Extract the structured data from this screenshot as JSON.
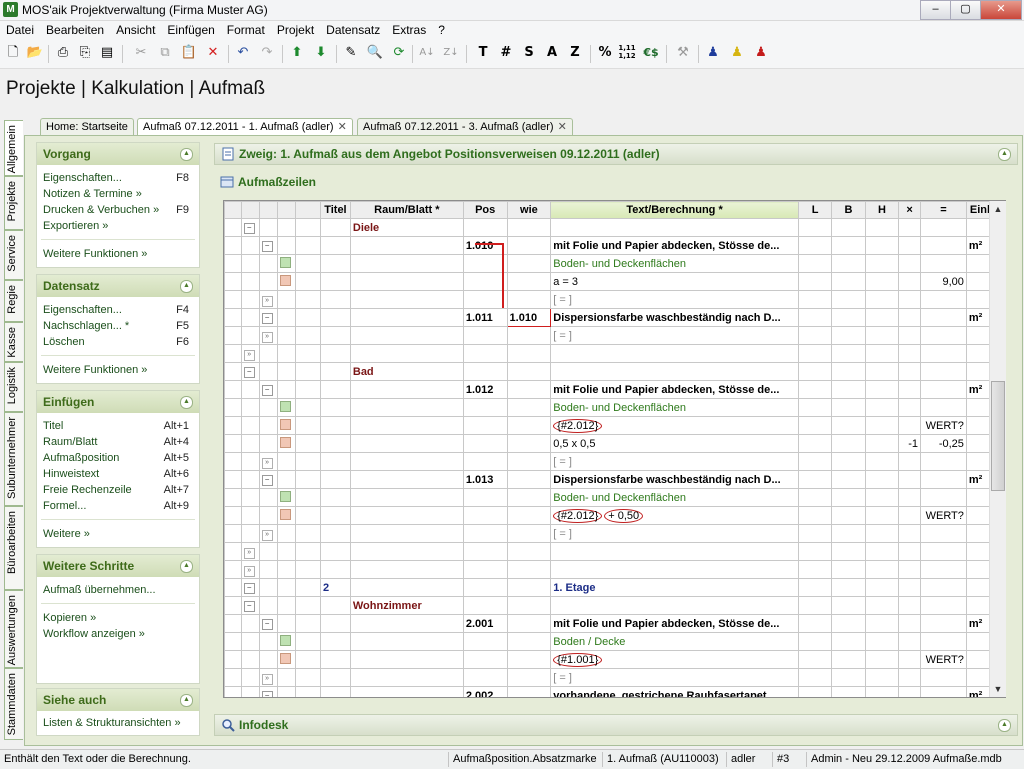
{
  "window": {
    "title": "MOS'aik Projektverwaltung (Firma Muster AG)",
    "min": "–",
    "max": "▢",
    "close": "✕"
  },
  "menu": [
    "Datei",
    "Bearbeiten",
    "Ansicht",
    "Einfügen",
    "Format",
    "Projekt",
    "Datensatz",
    "Extras",
    "?"
  ],
  "toolbar": {
    "t": "T",
    "hash": "#",
    "s": "S",
    "a": "A",
    "z": "Z",
    "pct": "%",
    "dec": "1,11 1,12",
    "eur": "€$"
  },
  "header": "Projekte | Kalkulation | Aufmaß",
  "vtabs": [
    "Allgemein",
    "Projekte",
    "Service",
    "Regie",
    "Kasse",
    "Logistik",
    "Subunternehmer",
    "Büroarbeiten",
    "Auswertungen",
    "Stammdaten"
  ],
  "doc_tabs": [
    {
      "label": "Home: Startseite",
      "closable": false
    },
    {
      "label": "Aufmaß 07.12.2011 - 1. Aufmaß (adler)",
      "closable": true
    },
    {
      "label": "Aufmaß 07.12.2011 - 3. Aufmaß (adler)",
      "closable": true
    }
  ],
  "sidebar": {
    "vorgang": {
      "title": "Vorgang",
      "items": [
        {
          "label": "Eigenschaften...",
          "key": "F8"
        },
        {
          "label": "Notizen & Termine »",
          "key": ""
        },
        {
          "label": "Drucken & Verbuchen »",
          "key": "F9"
        },
        {
          "label": "Exportieren »",
          "key": ""
        }
      ],
      "more": "Weitere Funktionen »"
    },
    "datensatz": {
      "title": "Datensatz",
      "items": [
        {
          "label": "Eigenschaften...",
          "key": "F4"
        },
        {
          "label": "Nachschlagen... *",
          "key": "F5"
        },
        {
          "label": "Löschen",
          "key": "F6"
        }
      ],
      "more": "Weitere Funktionen »"
    },
    "einfuegen": {
      "title": "Einfügen",
      "items": [
        {
          "label": "Titel",
          "key": "Alt+1"
        },
        {
          "label": "Raum/Blatt",
          "key": "Alt+4"
        },
        {
          "label": "Aufmaßposition",
          "key": "Alt+5"
        },
        {
          "label": "Hinweistext",
          "key": "Alt+6"
        },
        {
          "label": "Freie Rechenzeile",
          "key": "Alt+7"
        },
        {
          "label": "Formel...",
          "key": "Alt+9"
        }
      ],
      "more": "Weitere »"
    },
    "schritte": {
      "title": "Weitere Schritte",
      "items": [
        "Aufmaß übernehmen...",
        "Kopieren »",
        "Workflow anzeigen »"
      ]
    },
    "siehe": {
      "title": "Siehe auch",
      "items": [
        "Listen & Strukturansichten »"
      ]
    }
  },
  "branch": "Zweig: 1. Aufmaß aus dem Angebot Positionsverweisen 09.12.2011 (adler)",
  "rows_title": "Aufmaßzeilen",
  "infodesk": "Infodesk",
  "grid": {
    "columns": [
      "Titel",
      "Raum/Blatt *",
      "Pos",
      "wie",
      "Text/Berechnung *",
      "L",
      "B",
      "H",
      "×",
      "=",
      "Einh *"
    ],
    "rows": [
      {
        "t": "room",
        "raum": "Diele"
      },
      {
        "t": "pos",
        "pos": "1.010",
        "text": "mit Folie und Papier abdecken, Stösse de...",
        "einh": "m²"
      },
      {
        "t": "green",
        "text": "Boden- und Deckenflächen"
      },
      {
        "t": "calc",
        "text": "a = 3",
        "eq": "9,00"
      },
      {
        "t": "sum",
        "text": "[ = ]"
      },
      {
        "t": "pos",
        "pos": "1.011",
        "wie": "1.010",
        "text": "Dispersionsfarbe waschbeständig nach D...",
        "einh": "m²"
      },
      {
        "t": "sum",
        "text": "[ = ]"
      },
      {
        "t": "blank"
      },
      {
        "t": "room",
        "raum": "Bad"
      },
      {
        "t": "pos",
        "pos": "1.012",
        "text": "mit Folie und Papier abdecken, Stösse de...",
        "einh": "m²"
      },
      {
        "t": "green",
        "text": "Boden- und Deckenflächen"
      },
      {
        "t": "calc",
        "text": "{#2.012}",
        "eq": "WERT?",
        "circle": true
      },
      {
        "t": "calc",
        "text": "0,5 x 0,5",
        "x": "-1",
        "eq": "-0,25"
      },
      {
        "t": "sum",
        "text": "[ = ]"
      },
      {
        "t": "pos",
        "pos": "1.013",
        "text": "Dispersionsfarbe waschbeständig nach D...",
        "einh": "m²"
      },
      {
        "t": "green",
        "text": "Boden- und Deckenflächen"
      },
      {
        "t": "calc",
        "text": "{#2.012}",
        "text2": "+ 0,50",
        "eq": "WERT?",
        "circle": true
      },
      {
        "t": "sum",
        "text": "[ = ]"
      },
      {
        "t": "blank"
      },
      {
        "t": "blank"
      },
      {
        "t": "title",
        "titel": "2",
        "text": "1. Etage"
      },
      {
        "t": "room",
        "raum": "Wohnzimmer"
      },
      {
        "t": "pos",
        "pos": "2.001",
        "text": "mit Folie und Papier abdecken, Stösse de...",
        "einh": "m²"
      },
      {
        "t": "green",
        "text": "Boden / Decke"
      },
      {
        "t": "calc",
        "text": "{#1.001}",
        "eq": "WERT?",
        "circle": true
      },
      {
        "t": "sum",
        "text": "[ = ]"
      },
      {
        "t": "pos",
        "pos": "2.002",
        "text": "vorhandene, gestrichene Rauhfasertapet...",
        "einh": "m²"
      }
    ]
  },
  "status": {
    "hint": "Enthält den Text oder die Berechnung.",
    "field": "Aufmaßposition.Absatzmarke",
    "doc": "1. Aufmaß (AU110003)",
    "user": "adler",
    "num": "#3",
    "db": "Admin - Neu 29.12.2009 Aufmaße.mdb"
  }
}
